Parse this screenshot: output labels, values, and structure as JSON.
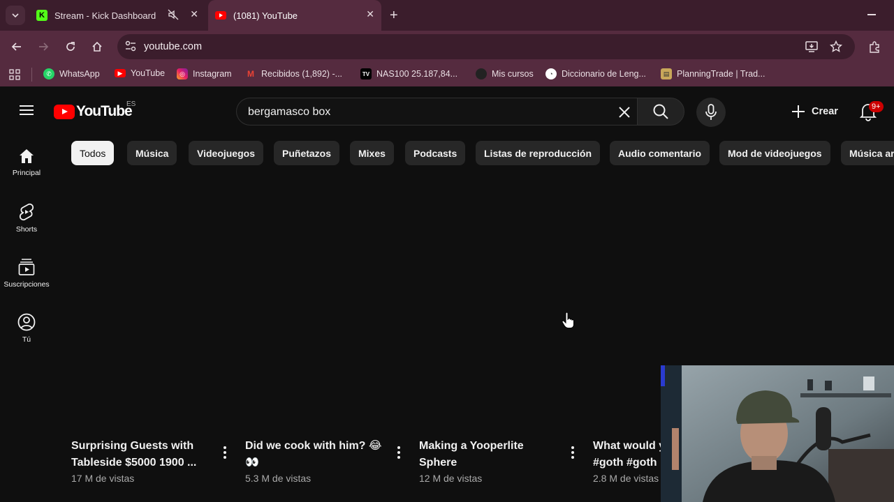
{
  "browser": {
    "tabs": [
      {
        "title": "Stream - Kick Dashboard",
        "favicon": "kick-icon"
      },
      {
        "title": "(1081) YouTube",
        "favicon": "youtube-icon",
        "active": true
      }
    ],
    "url": "youtube.com",
    "bookmarks": [
      {
        "label": "WhatsApp",
        "icon": "whatsapp-icon"
      },
      {
        "label": "YouTube",
        "icon": "youtube-icon"
      },
      {
        "label": "Instagram",
        "icon": "instagram-icon"
      },
      {
        "label": "Recibidos (1,892) -...",
        "icon": "gmail-icon"
      },
      {
        "label": "NAS100 25.187,84...",
        "icon": "tradingview-icon"
      },
      {
        "label": "Mis cursos",
        "icon": "circle-icon"
      },
      {
        "label": "Diccionario de Leng...",
        "icon": "rae-icon"
      },
      {
        "label": "PlanningTrade | Trad...",
        "icon": "planningtrade-icon"
      }
    ]
  },
  "youtube": {
    "logo_text": "YouTube",
    "region": "ES",
    "search_value": "bergamasco box",
    "create_label": "Crear",
    "notifications_badge": "9+",
    "sidebar": [
      {
        "label": "Principal",
        "icon": "home-icon"
      },
      {
        "label": "Shorts",
        "icon": "shorts-icon"
      },
      {
        "label": "Suscripciones",
        "icon": "subscriptions-icon"
      },
      {
        "label": "Tú",
        "icon": "user-icon"
      }
    ],
    "chips": [
      "Todos",
      "Música",
      "Videojuegos",
      "Puñetazos",
      "Mixes",
      "Podcasts",
      "Listas de reproducción",
      "Audio comentario",
      "Mod de videojuegos",
      "Música ar"
    ],
    "videos": [
      {
        "title": "Surprising Guests with Tableside $5000 1900 ...",
        "views": "17 M de vistas"
      },
      {
        "title": "Did we cook with him? 😂 👀",
        "views": "5.3 M de vistas"
      },
      {
        "title": "Making a Yooperlite Sphere",
        "views": "12 M de vistas"
      },
      {
        "title": "What would y #goth #goth",
        "views": "2.8 M de vistas"
      }
    ]
  },
  "colors": {
    "chrome_dark": "#3b1d2c",
    "chrome_mid": "#552b3f",
    "yt_bg": "#0f0f0f",
    "yt_red": "#ff0000"
  }
}
